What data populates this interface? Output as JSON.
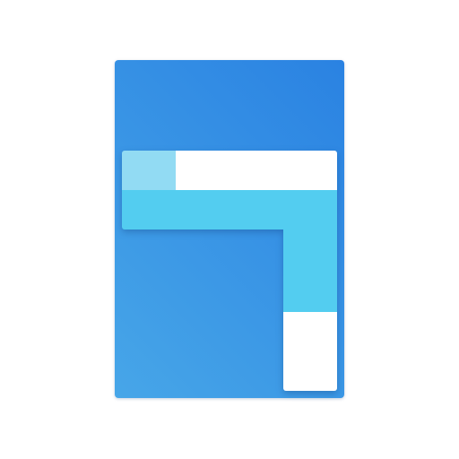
{
  "icon": {
    "name": "layout-app-icon",
    "colors": {
      "background_start": "#2a82e2",
      "background_end": "#47a6e8",
      "cyan": "#53cdf0",
      "light_cyan": "#92dbf3",
      "white": "#ffffff",
      "page": "#ffffff"
    }
  }
}
